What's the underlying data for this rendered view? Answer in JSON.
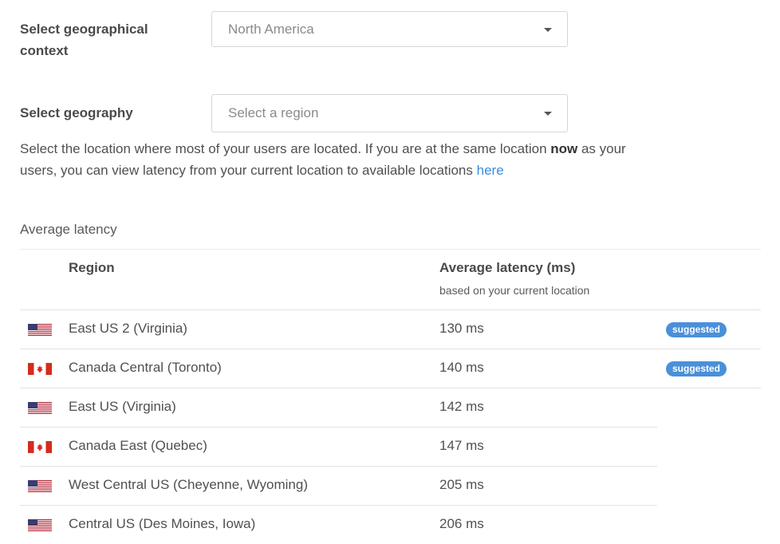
{
  "form": {
    "context_label": "Select geographical context",
    "context_value": "North America",
    "geography_label": "Select geography",
    "geography_placeholder": "Select a region"
  },
  "help": {
    "text_before": "Select the location where most of your users are located. If you are at the same location ",
    "text_bold": "now",
    "text_after": " as your users, you can view latency from your current location to available locations ",
    "link_text": "here"
  },
  "table": {
    "title": "Average latency",
    "header_region": "Region",
    "header_latency": "Average latency (ms)",
    "header_latency_sub": "based on your current location",
    "rows": [
      {
        "flag": "us-flag-icon",
        "region": "East US 2 (Virginia)",
        "latency": "130 ms",
        "badge": "suggested"
      },
      {
        "flag": "ca-flag-icon",
        "region": "Canada Central (Toronto)",
        "latency": "140 ms",
        "badge": "suggested"
      },
      {
        "flag": "us-flag-icon",
        "region": "East US (Virginia)",
        "latency": "142 ms",
        "badge": ""
      },
      {
        "flag": "ca-flag-icon",
        "region": "Canada East (Quebec)",
        "latency": "147 ms",
        "badge": ""
      },
      {
        "flag": "us-flag-icon",
        "region": "West Central US (Cheyenne, Wyoming)",
        "latency": "205 ms",
        "badge": ""
      },
      {
        "flag": "us-flag-icon",
        "region": "Central US (Des Moines, Iowa)",
        "latency": "206 ms",
        "badge": ""
      }
    ]
  },
  "colors": {
    "accent": "#3a8dde",
    "badge": "#4a90d9",
    "us_red": "#b22234",
    "us_blue": "#3c3b6e",
    "ca_red": "#d52b1e"
  }
}
